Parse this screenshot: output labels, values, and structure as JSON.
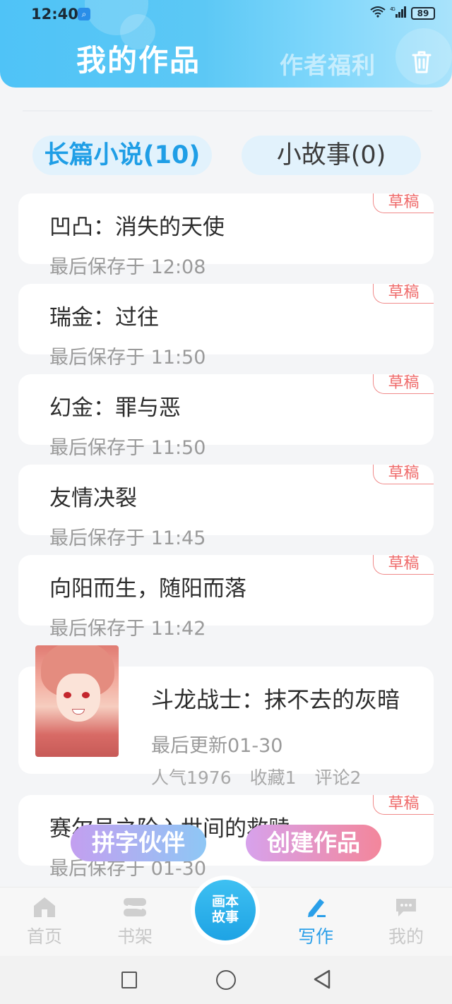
{
  "status_bar": {
    "time": "12:40",
    "network": "4G",
    "battery": "89"
  },
  "header": {
    "title": "我的作品",
    "welfare": "作者福利",
    "trash_icon": "trash-icon"
  },
  "tabs": [
    {
      "label": "长篇小说(10)",
      "active": true
    },
    {
      "label": "小故事(0)",
      "active": false
    }
  ],
  "works": [
    {
      "title": "凹凸：消失的天使",
      "saved": "最后保存于 12:08",
      "badge": "草稿"
    },
    {
      "title": "瑞金：过往",
      "saved": "最后保存于 11:50",
      "badge": "草稿"
    },
    {
      "title": "幻金：罪与恶",
      "saved": "最后保存于 11:50",
      "badge": "草稿"
    },
    {
      "title": "友情决裂",
      "saved": "最后保存于 11:45",
      "badge": "草稿"
    },
    {
      "title": "向阳而生，随阳而落",
      "saved": "最后保存于 11:42",
      "badge": "草稿"
    }
  ],
  "published": {
    "title": "斗龙战士：抹不去的灰暗",
    "updated": "最后更新01-30",
    "popularity": "人气1976",
    "favorites": "收藏1",
    "comments": "评论2"
  },
  "partial_work": {
    "title": "赛尔号之阶入世间的救赎",
    "saved": "最后保存于 01-30",
    "badge": "草稿"
  },
  "fab": {
    "partner": "拼字伙伴",
    "create": "创建作品"
  },
  "nav": {
    "items": [
      {
        "label": "首页",
        "icon": "home-icon"
      },
      {
        "label": "书架",
        "icon": "bookshelf-icon"
      },
      {
        "label": "写作",
        "icon": "pen-icon",
        "active": true
      },
      {
        "label": "我的",
        "icon": "chat-icon"
      }
    ],
    "center_line1": "画本",
    "center_line2": "故事"
  },
  "colors": {
    "accent": "#1f9ee6",
    "draft_badge": "#ef6b6b"
  }
}
